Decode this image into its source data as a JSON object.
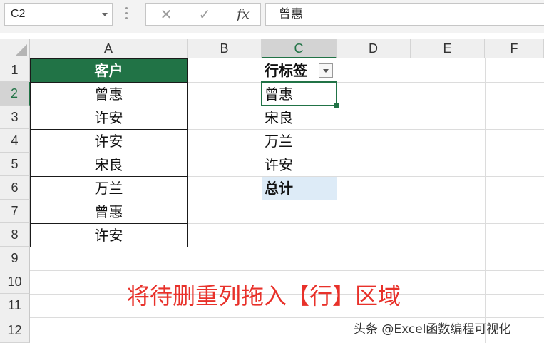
{
  "name_box": {
    "value": "C2"
  },
  "formula_bar": {
    "cancel_glyph": "✕",
    "confirm_glyph": "✓",
    "fx_label": "fx",
    "value": "曾惠"
  },
  "columns": [
    "A",
    "B",
    "C",
    "D",
    "E",
    "F"
  ],
  "rows": [
    "1",
    "2",
    "3",
    "4",
    "5",
    "6",
    "7",
    "8",
    "9",
    "10",
    "11",
    "12"
  ],
  "column_a": {
    "header": "客户",
    "values": [
      "曾惠",
      "许安",
      "许安",
      "宋良",
      "万兰",
      "曾惠",
      "许安"
    ]
  },
  "pivot": {
    "header": "行标签",
    "items": [
      "曾惠",
      "宋良",
      "万兰",
      "许安"
    ],
    "total": "总计"
  },
  "caption": "将待删重列拖入【行】区域",
  "watermark": "头条 @Excel函数编程可视化",
  "colors": {
    "accent_green": "#217346",
    "caption_red": "#e8312a",
    "total_fill": "#ddebf7"
  },
  "icons": [
    "dropdown-arrow-icon",
    "cancel-icon",
    "confirm-icon",
    "fx-icon",
    "filter-dropdown-icon",
    "select-all-icon"
  ]
}
